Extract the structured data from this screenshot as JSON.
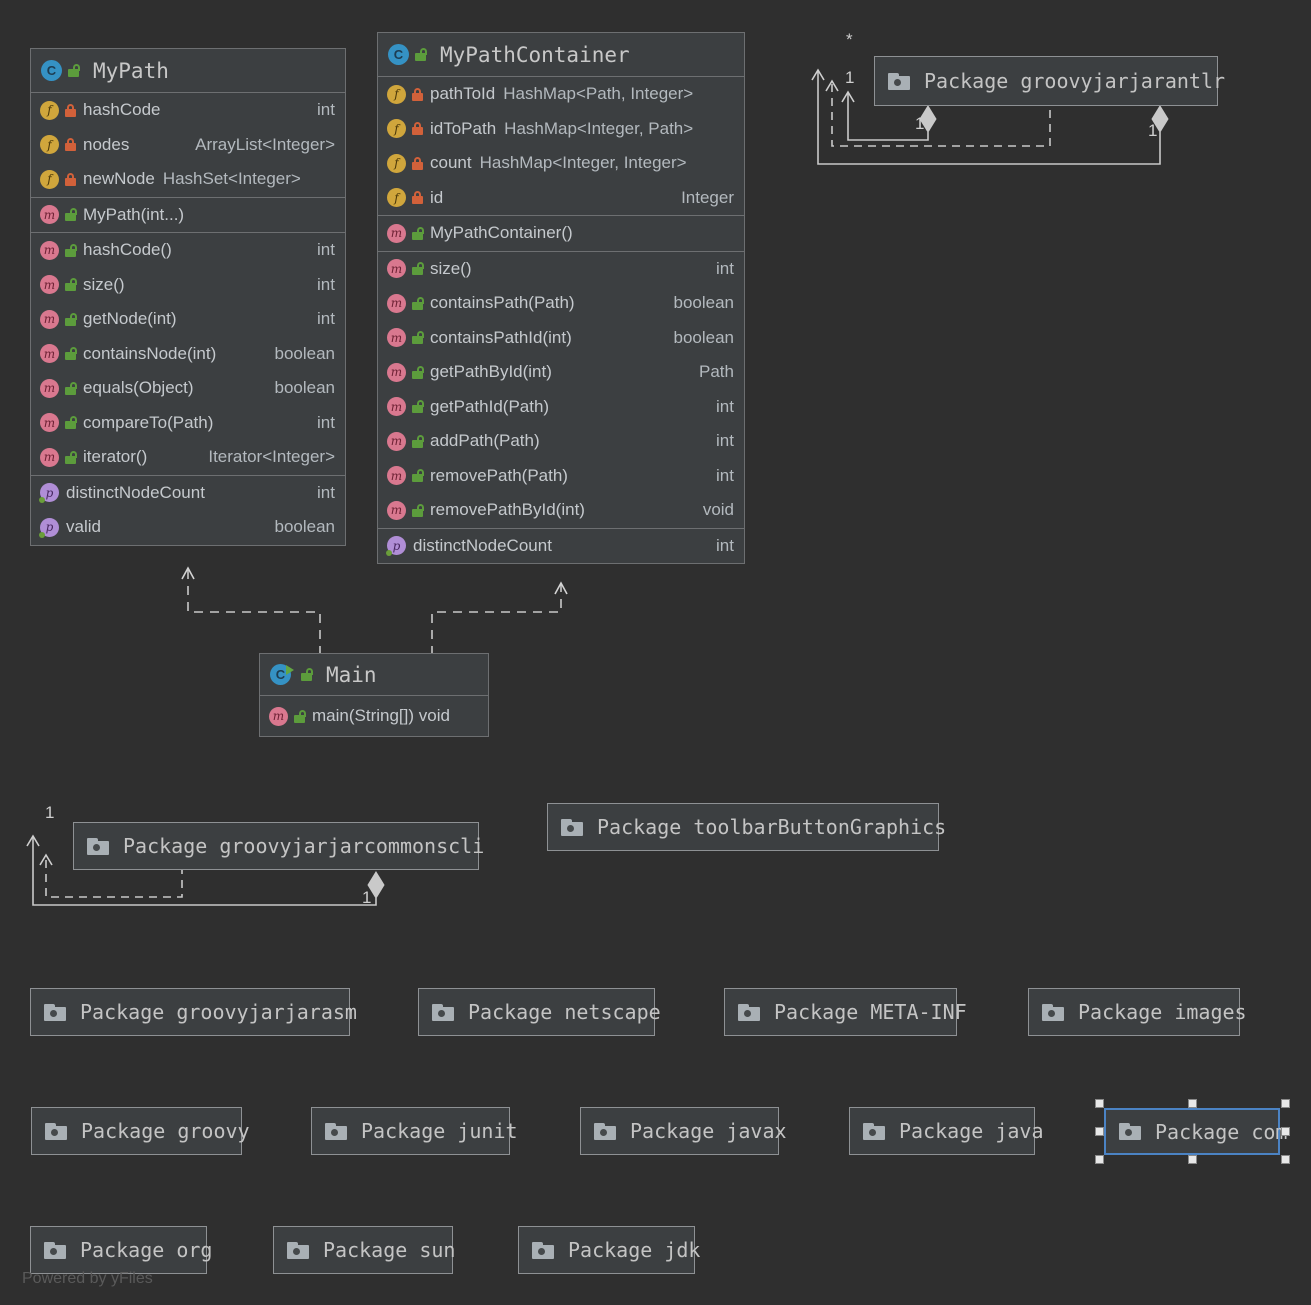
{
  "diagram": {
    "background": "#2f2f2f",
    "watermark": "Powered by yFiles",
    "accent_selected": "#4b83c4"
  },
  "classes": [
    {
      "name": "MyPath",
      "icon": "class-icon",
      "visibility_icon": "unlock-public-icon",
      "fields": [
        {
          "icon": "field-icon",
          "lock": "lock-private-icon",
          "name": "hashCode",
          "type": "int",
          "type_align": "right"
        },
        {
          "icon": "field-icon",
          "lock": "lock-private-icon",
          "name": "nodes",
          "type": "ArrayList<Integer>",
          "type_align": "right"
        },
        {
          "icon": "field-icon",
          "lock": "lock-private-icon",
          "name": "newNode",
          "type": "HashSet<Integer>",
          "type_align": "inline"
        }
      ],
      "constructors": [
        {
          "icon": "method-icon",
          "lock": "unlock-public-icon",
          "name": "MyPath(int...)",
          "type": ""
        }
      ],
      "methods": [
        {
          "icon": "method-icon",
          "lock": "unlock-public-icon",
          "name": "hashCode()",
          "type": "int"
        },
        {
          "icon": "method-icon",
          "lock": "unlock-public-icon",
          "name": "size()",
          "type": "int"
        },
        {
          "icon": "method-icon",
          "lock": "unlock-public-icon",
          "name": "getNode(int)",
          "type": "int"
        },
        {
          "icon": "method-icon",
          "lock": "unlock-public-icon",
          "name": "containsNode(int)",
          "type": "boolean"
        },
        {
          "icon": "method-icon",
          "lock": "unlock-public-icon",
          "name": "equals(Object)",
          "type": "boolean"
        },
        {
          "icon": "method-icon",
          "lock": "unlock-public-icon",
          "name": "compareTo(Path)",
          "type": "int"
        },
        {
          "icon": "method-icon",
          "lock": "unlock-public-icon",
          "name": "iterator()",
          "type": "Iterator<Integer>"
        }
      ],
      "properties": [
        {
          "icon": "property-icon",
          "name": "distinctNodeCount",
          "type": "int"
        },
        {
          "icon": "property-icon",
          "name": "valid",
          "type": "boolean"
        }
      ]
    },
    {
      "name": "MyPathContainer",
      "icon": "class-icon",
      "visibility_icon": "unlock-public-icon",
      "fields": [
        {
          "icon": "field-icon",
          "lock": "lock-private-icon",
          "name": "pathToId",
          "type": "HashMap<Path, Integer>",
          "type_align": "inline"
        },
        {
          "icon": "field-icon",
          "lock": "lock-private-icon",
          "name": "idToPath",
          "type": "HashMap<Integer, Path>",
          "type_align": "inline"
        },
        {
          "icon": "field-icon",
          "lock": "lock-private-icon",
          "name": "count",
          "type": "HashMap<Integer, Integer>",
          "type_align": "inline"
        },
        {
          "icon": "field-icon",
          "lock": "lock-private-icon",
          "name": "id",
          "type": "Integer",
          "type_align": "right"
        }
      ],
      "constructors": [
        {
          "icon": "method-icon",
          "lock": "unlock-public-icon",
          "name": "MyPathContainer()",
          "type": ""
        }
      ],
      "methods": [
        {
          "icon": "method-icon",
          "lock": "unlock-public-icon",
          "name": "size()",
          "type": "int"
        },
        {
          "icon": "method-icon",
          "lock": "unlock-public-icon",
          "name": "containsPath(Path)",
          "type": "boolean"
        },
        {
          "icon": "method-icon",
          "lock": "unlock-public-icon",
          "name": "containsPathId(int)",
          "type": "boolean"
        },
        {
          "icon": "method-icon",
          "lock": "unlock-public-icon",
          "name": "getPathById(int)",
          "type": "Path"
        },
        {
          "icon": "method-icon",
          "lock": "unlock-public-icon",
          "name": "getPathId(Path)",
          "type": "int"
        },
        {
          "icon": "method-icon",
          "lock": "unlock-public-icon",
          "name": "addPath(Path)",
          "type": "int"
        },
        {
          "icon": "method-icon",
          "lock": "unlock-public-icon",
          "name": "removePath(Path)",
          "type": "int"
        },
        {
          "icon": "method-icon",
          "lock": "unlock-public-icon",
          "name": "removePathById(int)",
          "type": "void"
        }
      ],
      "properties": [
        {
          "icon": "property-icon",
          "name": "distinctNodeCount",
          "type": "int"
        }
      ]
    },
    {
      "name": "Main",
      "icon": "class-runnable-icon",
      "visibility_icon": "unlock-public-icon",
      "fields": [],
      "constructors": [],
      "methods": [
        {
          "icon": "method-icon",
          "lock": "unlock-public-icon",
          "name": "main(String[]) void",
          "type": ""
        }
      ],
      "properties": []
    }
  ],
  "packages": [
    {
      "id": "groovyjarjarantlr",
      "label": "Package groovyjarjarantlr",
      "icon": "folder-icon",
      "selected": false
    },
    {
      "id": "groovyjarjarcommonscli",
      "label": "Package groovyjarjarcommonscli",
      "icon": "folder-icon",
      "selected": false
    },
    {
      "id": "toolbarButtonGraphics",
      "label": "Package toolbarButtonGraphics",
      "icon": "folder-icon",
      "selected": false
    },
    {
      "id": "groovyjarjarasm",
      "label": "Package groovyjarjarasm",
      "icon": "folder-icon",
      "selected": false
    },
    {
      "id": "netscape",
      "label": "Package netscape",
      "icon": "folder-icon",
      "selected": false
    },
    {
      "id": "META-INF",
      "label": "Package META-INF",
      "icon": "folder-icon",
      "selected": false
    },
    {
      "id": "images",
      "label": "Package images",
      "icon": "folder-icon",
      "selected": false
    },
    {
      "id": "groovy",
      "label": "Package groovy",
      "icon": "folder-icon",
      "selected": false
    },
    {
      "id": "junit",
      "label": "Package junit",
      "icon": "folder-icon",
      "selected": false
    },
    {
      "id": "javax",
      "label": "Package javax",
      "icon": "folder-icon",
      "selected": false
    },
    {
      "id": "java",
      "label": "Package java",
      "icon": "folder-icon",
      "selected": false
    },
    {
      "id": "com",
      "label": "Package com",
      "icon": "folder-icon",
      "selected": true
    },
    {
      "id": "org",
      "label": "Package org",
      "icon": "folder-icon",
      "selected": false
    },
    {
      "id": "sun",
      "label": "Package sun",
      "icon": "folder-icon",
      "selected": false
    },
    {
      "id": "jdk",
      "label": "Package jdk",
      "icon": "folder-icon",
      "selected": false
    }
  ],
  "edge_labels": {
    "antlr_star": "*",
    "antlr_left_one": "1",
    "antlr_inner_one": "1",
    "antlr_right_one": "1",
    "commonscli_top_one": "1",
    "commonscli_bottom_one": "1"
  }
}
